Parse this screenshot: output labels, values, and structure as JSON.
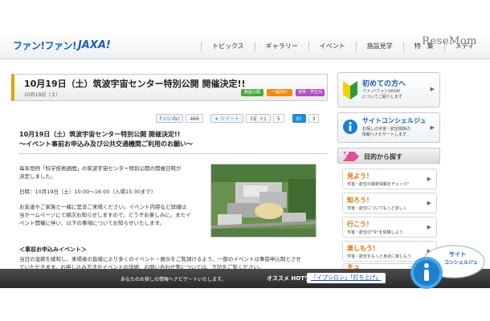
{
  "header": {
    "logo_text": "ファン!ファン!",
    "logo_jaxa": "JAXA!",
    "nav": [
      "トピックス",
      "ギャラリー",
      "イベント",
      "施設見学",
      "特　集",
      "メディ"
    ],
    "watermark": "ReseMom"
  },
  "article": {
    "title": "10月19日（土）筑波宇宙センター特別公開 開催決定!!",
    "date": "10月19日（土）",
    "tags": [
      "施設公開",
      "一般向け",
      "家族・学生向"
    ],
    "social": [
      {
        "label": "いいね!",
        "count": "466"
      },
      {
        "label": "ツイート",
        "count": "157"
      },
      {
        "label": "+1",
        "count": "5"
      },
      {
        "label": "B!",
        "count": "3"
      }
    ],
    "subhead_line1": "10月19日（土）筑波宇宙センター特別公開 開催決定!!",
    "subhead_line2": "～イベント事前お申込み及び公共交通機関ご利用のお願い～",
    "para1_line1": "毎年恒例「科学技術週間」の筑波宇宙センター特別公開の開催日時が",
    "para1_line2": "決定しました。",
    "para2": "日時：10月19日（土）10:00〜16:00（入場15:30まで）",
    "para3_line1": "お友達やご家族と一緒に是非ご来場ください。イベント内容など詳細は",
    "para3_line2": "当ホームページにて順次お知らせしますので、どうぞお楽しみに。またイ",
    "para3_line3": "ベント開催に伴い、以下の事項についてお知らせいたします。",
    "event_head": "＜事前お申込みイベント＞",
    "para4_line1": "当日の混雑を緩和し、来場者の皆様により多くのイベント・展示をご覧頂けるよう、一部のイベントは事前申込制とさせ",
    "para4_line2": "ていただきます。お申し込み方法やイベントの詳細、お問い合わせ等については、下記をご覧ください。"
  },
  "sidebar": {
    "first_visit_title": "初めての方へ",
    "first_visit_desc1": "ファン!ファン!JAXA!",
    "first_visit_desc2": "についてご紹介します",
    "concierge_title": "サイトコンシェルジュ",
    "concierge_desc1": "お探しの宇宙・航空関係の",
    "concierge_desc2": "情報へナビゲートします",
    "explore_title": "目的から探す",
    "explore_items": [
      {
        "title": "見よう！",
        "desc": "宇宙・航空の最新情報をチェック!"
      },
      {
        "title": "知ろう！",
        "desc": "宇宙・航空についてもっと詳しく"
      },
      {
        "title": "行こう！",
        "desc": "宇宙・航空の\"今\"を体験しよう"
      },
      {
        "title": "楽しもう！",
        "desc": "宇宙・航空をもっと身近に楽しもう"
      }
    ],
    "next_partial": "キュ"
  },
  "bottom_bar": {
    "message": "あなたのお探しの情報へナビゲートいたします。",
    "hot_label": "オススメ HOTワード",
    "hot_words": "「イプシロン」「打ち上げ」"
  },
  "floating": {
    "line1": "サイト",
    "line2": "コンシェルジュ"
  },
  "colors": {
    "brand_blue": "#1b5fb8",
    "accent_orange": "#e26b00",
    "bottom_bar": "#333333"
  }
}
